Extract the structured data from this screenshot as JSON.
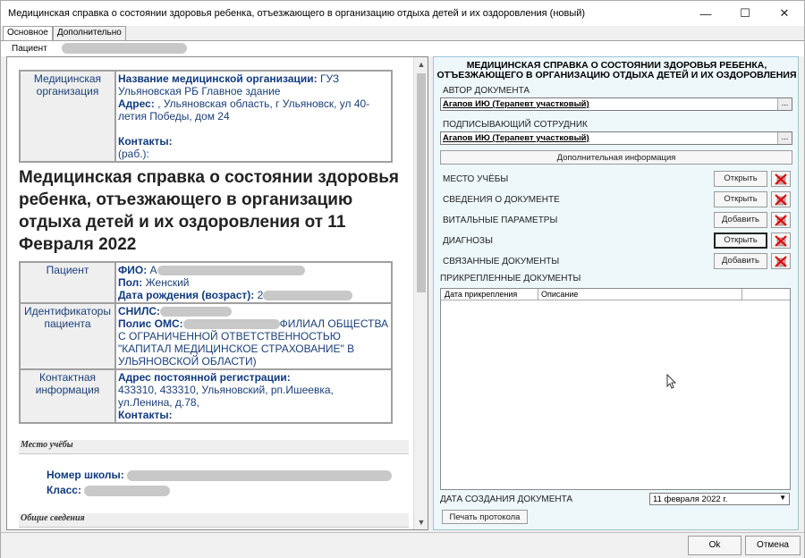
{
  "window": {
    "title": "Медицинская справка о состоянии здоровья ребенка, отъезжающего в организацию отдыха детей и их оздоровления (новый)",
    "minimize": "—",
    "maximize": "☐",
    "close": "✕"
  },
  "tabs": [
    {
      "label": "Основное"
    },
    {
      "label": "Дополнительно"
    }
  ],
  "patient": {
    "label": "Пациент"
  },
  "document": {
    "org": {
      "label": "Медицинская организация",
      "name_key": "Название медицинской организации:",
      "name_val": " ГУЗ Ульяновская РБ Главное здание",
      "addr_key": "Адрес:",
      "addr_val": " , Ульяновская область, г Ульяновск, ул 40-летия Победы, дом 24",
      "contacts_key": "Контакты:",
      "contacts_val": "(раб.):"
    },
    "title": "Медицинская справка о состоянии здоровья ребенка, отъезжающего в организацию отдыха детей и их оздоровления от 11 Февраля 2022",
    "patient": {
      "label": "Пациент",
      "fio_key": "ФИО:",
      "fio_val": " А",
      "sex_key": "Пол:",
      "sex_val": " Женский",
      "dob_key": "Дата рождения (возраст):",
      "dob_val": " 2"
    },
    "ids": {
      "label": "Идентификаторы пациента",
      "snils_key": "СНИЛС:",
      "oms_key": "Полис ОМС:",
      "oms_val": "ФИЛИАЛ ОБЩЕСТВА С ОГРАНИЧЕННОЙ ОТВЕТСТВЕННОСТЬЮ \"КАПИТАЛ МЕДИЦИНСКОЕ СТРАХОВАНИЕ\" В УЛЬЯНОВСКОЙ ОБЛАСТИ)"
    },
    "contact": {
      "label": "Контактная информация",
      "addr_key": "Адрес постоянной регистрации:",
      "addr_val": "433310, 433310, Ульяновский, рп.Ишеевка, ул.Ленина, д.78,",
      "contacts_key": "Контакты:"
    },
    "section_study": "Место учёбы",
    "school_label": "Номер школы:",
    "class_label": "Класс:",
    "section_general": "Общие сведения"
  },
  "right": {
    "title_line1": "МЕДИЦИНСКАЯ СПРАВКА О СОСТОЯНИИ ЗДОРОВЬЯ РЕБЕНКА,",
    "title_line2": "ОТЪЕЗЖАЮЩЕГО В ОРГАНИЗАЦИЮ ОТДЫХА ДЕТЕЙ И ИХ ОЗДОРОВЛЕНИЯ",
    "author_label": "АВТОР ДОКУМЕНТА",
    "author_value": "Агапов ИЮ (Терапевт участковый)",
    "signer_label": "ПОДПИСЫВАЮЩИЙ СОТРУДНИК",
    "signer_value": "Агапов ИЮ (Терапевт участковый)",
    "dots": "...",
    "extra_info_button": "Дополнительная информация",
    "sections": [
      {
        "label": "МЕСТО УЧЁБЫ",
        "button": "Открыть"
      },
      {
        "label": "СВЕДЕНИЯ О ДОКУМЕНТЕ",
        "button": "Открыть"
      },
      {
        "label": "ВИТАЛЬНЫЕ ПАРАМЕТРЫ",
        "button": "Добавить"
      },
      {
        "label": "ДИАГНОЗЫ",
        "button": "Открыть"
      },
      {
        "label": "СВЯЗАННЫЕ ДОКУМЕНТЫ",
        "button": "Добавить"
      }
    ],
    "attached_label": "ПРИКРЕПЛЕННЫЕ ДОКУМЕНТЫ",
    "grid_cols": [
      "Дата прикрепления",
      "Описание"
    ],
    "created_label": "ДАТА СОЗДАНИЯ ДОКУМЕНТА",
    "created_value": "11 февраля  2022 г.",
    "print_button": "Печать протокола"
  },
  "footer": {
    "ok": "Ok",
    "cancel": "Отмена"
  }
}
